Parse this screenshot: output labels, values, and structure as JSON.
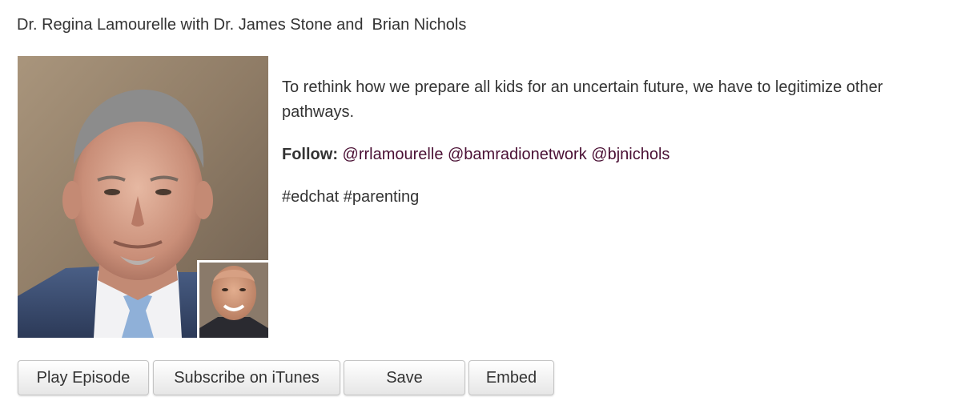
{
  "header": {
    "title": "Dr. Regina Lamourelle with Dr. James Stone and  Brian Nichols"
  },
  "episode": {
    "description": "To rethink how we prepare all kids for an uncertain future, we have to legitimize other pathways.",
    "follow_label": "Follow:",
    "follow_links": [
      "@rrlamourelle",
      "@bamradionetwork",
      "@bjnichols"
    ],
    "hashtags": "#edchat #parenting"
  },
  "buttons": {
    "play": "Play Episode",
    "subscribe": "Subscribe on iTunes",
    "save": "Save",
    "embed": "Embed"
  },
  "colors": {
    "text": "#333333",
    "link": "#4a1034",
    "button_border": "#c4c4c4"
  }
}
